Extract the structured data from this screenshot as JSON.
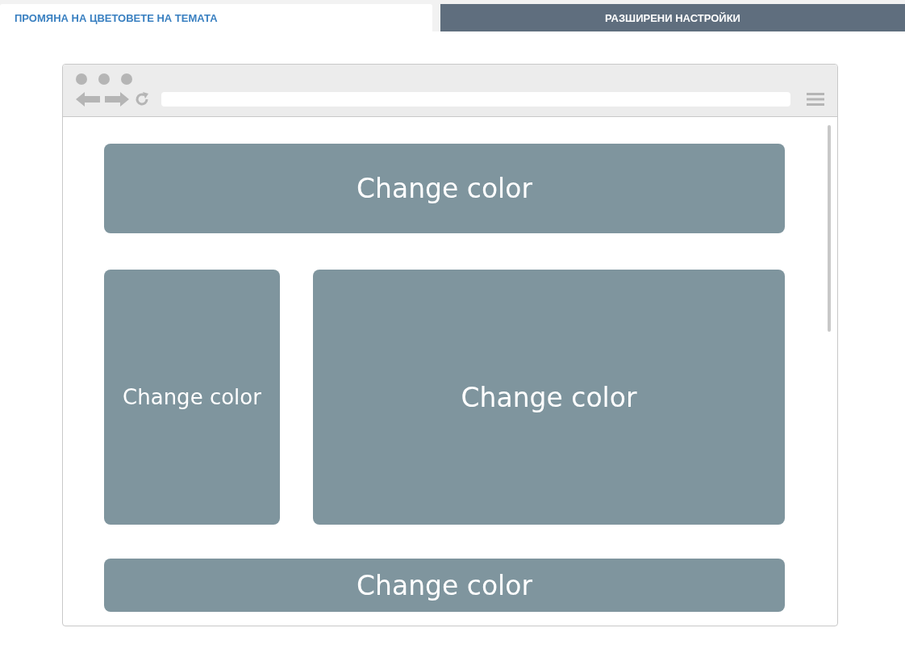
{
  "tabs": [
    {
      "label": "ПРОМЯНА НА ЦВЕТОВЕТЕ НА ТЕМАТА",
      "selected": true
    },
    {
      "label": "РАЗШИРЕНИ НАСТРОЙКИ",
      "selected": false
    }
  ],
  "preview": {
    "panels": [
      {
        "kind": "wide",
        "label": "Change color"
      },
      {
        "kind": "narrow",
        "label": "Change color"
      },
      {
        "kind": "large",
        "label": "Change color"
      },
      {
        "kind": "strip",
        "label": "Change color"
      }
    ]
  }
}
